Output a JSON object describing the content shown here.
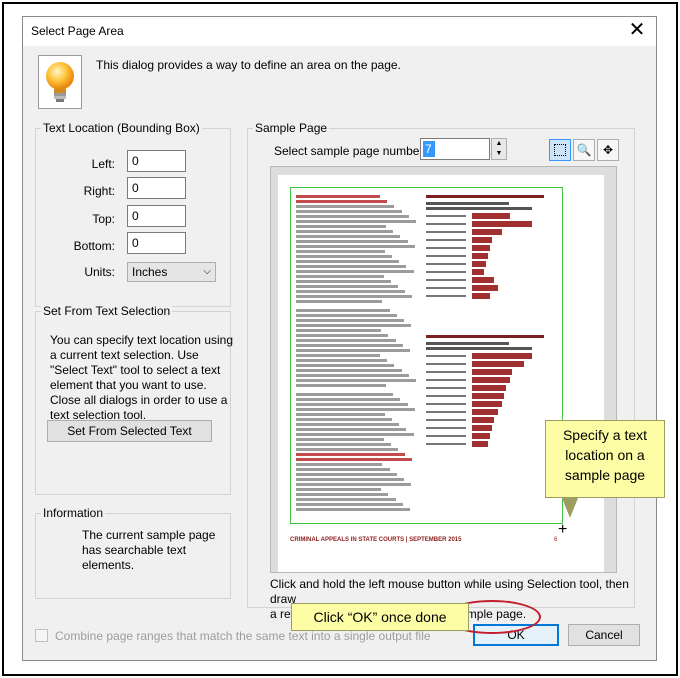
{
  "dialog": {
    "title": "Select Page Area",
    "close_glyph": "✕",
    "intro": "This dialog provides a way to define an area on the page."
  },
  "text_location": {
    "legend": "Text Location (Bounding Box)",
    "left_label": "Left:",
    "left_value": "0",
    "right_label": "Right:",
    "right_value": "0",
    "top_label": "Top:",
    "top_value": "0",
    "bottom_label": "Bottom:",
    "bottom_value": "0",
    "units_label": "Units:",
    "units_value": "Inches"
  },
  "set_from_selection": {
    "legend": "Set From Text Selection",
    "description_lines": [
      "You can specify text location using",
      "a current text selection.  Use",
      "\"Select Text\" tool to select a text",
      "element that you want to use.",
      "Close all dialogs in order to use a",
      "text selection tool."
    ],
    "button": "Set From Selected Text"
  },
  "information": {
    "legend": "Information",
    "lines": [
      "The current sample page",
      "has searchable text",
      "elements."
    ]
  },
  "sample_page": {
    "legend": "Sample Page",
    "number_label": "Select sample page number:",
    "page_number": "7",
    "footer_text": "CRIMINAL APPEALS IN STATE COURTS | SEPTEMBER 2015",
    "page_num": "6",
    "instructions_lines": [
      "Click and hold the left mouse button while using Selection tool, then draw",
      "a rectangle around an area on the sample page."
    ]
  },
  "tools": [
    "selection-tool",
    "zoom-tool",
    "pan-tool"
  ],
  "callouts": {
    "specify_lines": [
      "Specify a text",
      "location on a",
      "sample page"
    ],
    "ok_hint": "Click “OK” once done"
  },
  "footer": {
    "combine_label": "Combine page ranges that match the same text into a single output file",
    "combine_checked": false,
    "ok_label": "OK",
    "cancel_label": "Cancel"
  },
  "colors": {
    "callout_bg": "#fdfda5",
    "highlight_ring": "#c21e2d",
    "selection_box": "#43c343",
    "chart_bars": "#a13030"
  }
}
